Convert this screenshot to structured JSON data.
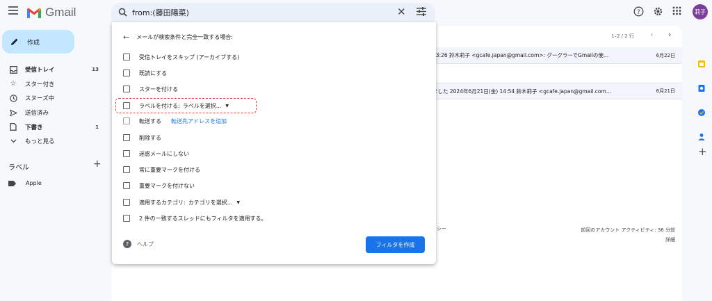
{
  "app": {
    "name": "Gmail"
  },
  "search": {
    "query": "from:(藤田陽菜)"
  },
  "account": {
    "avatar_text": "莉子"
  },
  "compose": {
    "label": "作成"
  },
  "nav": [
    {
      "icon": "inbox-icon",
      "label": "受信トレイ",
      "count": "13",
      "bold": true
    },
    {
      "icon": "star-icon",
      "label": "スター付き",
      "count": ""
    },
    {
      "icon": "clock-icon",
      "label": "スヌーズ中",
      "count": ""
    },
    {
      "icon": "send-icon",
      "label": "送信済み",
      "count": ""
    },
    {
      "icon": "file-icon",
      "label": "下書き",
      "count": "1",
      "bold": true
    },
    {
      "icon": "chevron-down-icon",
      "label": "もっと見る",
      "count": ""
    }
  ],
  "labels": {
    "heading": "ラベル",
    "items": [
      {
        "label": "Apple"
      }
    ]
  },
  "mail": {
    "pager": "1–2 / 2 行",
    "rows": [
      {
        "snippet": "13:26 鈴木莉子 <gcafe.japan@gmail.com>: グーグラーでGmailの使...",
        "date": "6月22日"
      },
      {
        "snippet": "ました 2024年6月21日(金) 14:54 鈴木莉子 <gcafe.japan@gmail.com...",
        "date": "6月21日"
      }
    ],
    "footer_left": "リシー",
    "footer_right_1": "前回のアカウント アクティビティ: 36 分前",
    "footer_right_2": "詳細"
  },
  "filter_panel": {
    "heading": "メールが検索条件と完全一致する場合:",
    "options": [
      {
        "label": "受信トレイをスキップ (アーカイブする)"
      },
      {
        "label": "既読にする"
      },
      {
        "label": "スターを付ける"
      },
      {
        "label": "ラベルを付ける:",
        "dropdown": "ラベルを選択..."
      },
      {
        "label": "転送する",
        "link": "転送先アドレスを追加"
      },
      {
        "label": "削除する"
      },
      {
        "label": "迷惑メールにしない"
      },
      {
        "label": "常に重要マークを付ける"
      },
      {
        "label": "重要マークを付けない"
      },
      {
        "label": "適用するカテゴリ:",
        "dropdown": "カテゴリを選択..."
      },
      {
        "label": "2 件の一致するスレッドにもフィルタを適用する。"
      }
    ],
    "help_label": "ヘルプ",
    "create_label": "フィルタを作成"
  },
  "colors": {
    "accent": "#1a73e8",
    "highlight": "#e53935",
    "compose_bg": "#c2e7ff"
  }
}
